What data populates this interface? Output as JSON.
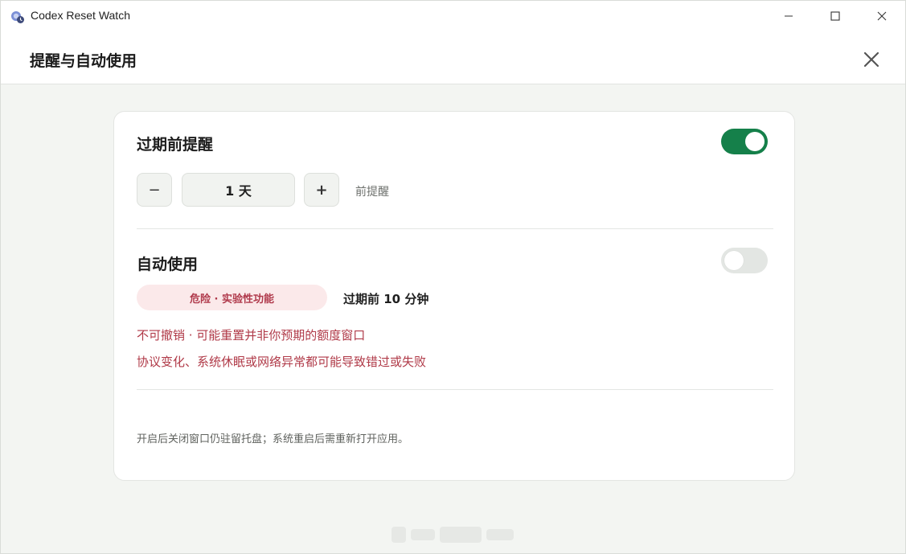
{
  "window": {
    "title": "Codex Reset Watch"
  },
  "header": {
    "title": "提醒与自动使用"
  },
  "reminder": {
    "title": "过期前提醒",
    "enabled": true,
    "decrement_label": "−",
    "increment_label": "+",
    "value": "1 天",
    "suffix": "前提醒"
  },
  "auto_use": {
    "title": "自动使用",
    "enabled": false,
    "badge": "危险 · 实验性功能",
    "timing": "过期前 10 分钟",
    "warnings": [
      "不可撤销 · 可能重置并非你预期的额度窗口",
      "协议变化、系统休眠或网络异常都可能导致错过或失败"
    ]
  },
  "footer_note": "开启后关闭窗口仍驻留托盘；系统重启后需重新打开应用。",
  "colors": {
    "toggle_on": "#15804a",
    "toggle_off": "#e3e6e3",
    "danger_text": "#b03a48",
    "danger_bg": "#fbe9ea"
  }
}
